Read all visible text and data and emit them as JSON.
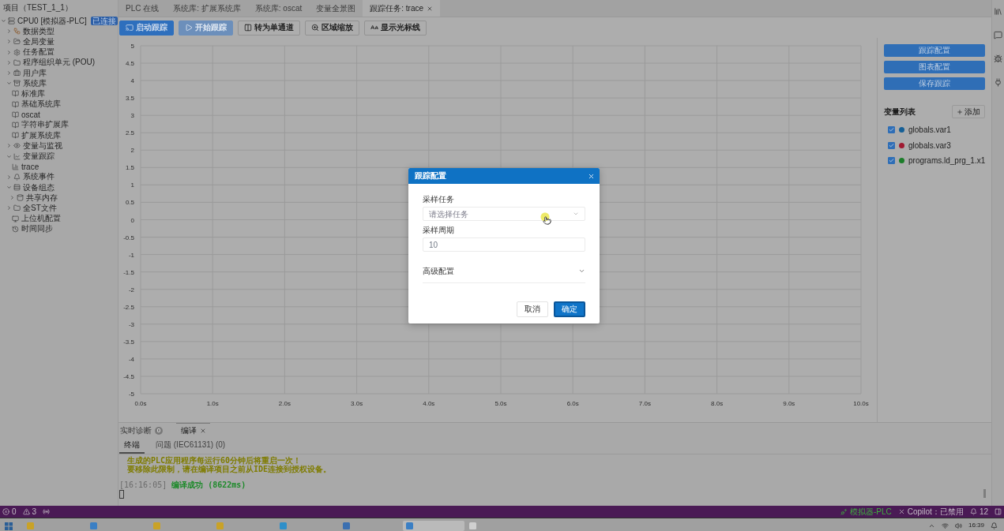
{
  "sidebar": {
    "title": "项目（TEST_1_1）",
    "tree": [
      {
        "label": "CPU0 [模拟器-PLC]",
        "badge": "已连接",
        "expanded": true,
        "children": [
          {
            "label": "数据类型",
            "expanded": false
          },
          {
            "label": "全局变量",
            "expanded": false
          },
          {
            "label": "任务配置",
            "expanded": false
          },
          {
            "label": "程序组织单元 (POU)",
            "expanded": false
          },
          {
            "label": "用户库",
            "expanded": false
          },
          {
            "label": "系统库",
            "expanded": true,
            "children": [
              {
                "label": "标准库"
              },
              {
                "label": "基础系统库"
              },
              {
                "label": "oscat"
              },
              {
                "label": "字符串扩展库"
              },
              {
                "label": "扩展系统库"
              }
            ]
          },
          {
            "label": "变量与监视",
            "expanded": false
          },
          {
            "label": "变量跟踪",
            "expanded": true,
            "children": [
              {
                "label": "trace"
              }
            ]
          },
          {
            "label": "系统事件",
            "expanded": false
          },
          {
            "label": "设备组态",
            "expanded": true,
            "children": [
              {
                "label": "共享内存",
                "expanded": false
              }
            ]
          },
          {
            "label": "全ST文件",
            "expanded": false
          },
          {
            "label": "上位机配置"
          },
          {
            "label": "时间同步"
          }
        ]
      }
    ]
  },
  "tabs": [
    {
      "label": "PLC 在线",
      "selected": false
    },
    {
      "label": "系统库: 扩展系统库",
      "selected": false
    },
    {
      "label": "系统库: oscat",
      "selected": false
    },
    {
      "label": "变量全景图",
      "selected": false
    },
    {
      "label": "跟踪任务: trace",
      "selected": true
    }
  ],
  "toolbar": [
    {
      "label": "启动跟踪",
      "kind": "primary",
      "disabled": false
    },
    {
      "label": "开始跟踪",
      "kind": "primary",
      "disabled": true
    },
    {
      "label": "转为单通道",
      "kind": "default",
      "disabled": false
    },
    {
      "label": "区域缩放",
      "kind": "default",
      "disabled": false
    },
    {
      "label": "显示光标线",
      "kind": "default",
      "disabled": false
    }
  ],
  "chart": {
    "chart_data": {
      "type": "line",
      "grid": true,
      "xlim": [
        0,
        10
      ],
      "ylim": [
        -5,
        5
      ],
      "xticks": [
        {
          "value": 0,
          "label": "0.0s"
        },
        {
          "value": 1,
          "label": "1.0s"
        },
        {
          "value": 2,
          "label": "2.0s"
        },
        {
          "value": 3,
          "label": "3.0s"
        },
        {
          "value": 4,
          "label": "4.0s"
        },
        {
          "value": 5,
          "label": "5.0s"
        },
        {
          "value": 6,
          "label": "6.0s"
        },
        {
          "value": 7,
          "label": "7.0s"
        },
        {
          "value": 8,
          "label": "8.0s"
        },
        {
          "value": 9,
          "label": "9.0s"
        },
        {
          "value": 10,
          "label": "10.0s"
        }
      ],
      "yticks": [
        5,
        4.5,
        4,
        3.5,
        3,
        2.5,
        2,
        1.5,
        1,
        0.5,
        0,
        -0.5,
        -1,
        -1.5,
        -2,
        -2.5,
        -3,
        -3.5,
        -4,
        -4.5,
        -5
      ]
    }
  },
  "trace_panel": {
    "buttons": [
      "跟踪配置",
      "图表配置",
      "保存跟踪"
    ],
    "variables_title": "变量列表",
    "add_button": "添加",
    "variables": [
      {
        "name": "globals.var1",
        "checked": true,
        "color": "#155f96"
      },
      {
        "name": "globals.var3",
        "checked": true,
        "color": "#a01a32"
      },
      {
        "name": "programs.ld_prg_1.x1",
        "checked": true,
        "color": "#1c7d2a"
      }
    ]
  },
  "bottom_panel": {
    "tabs": [
      {
        "label": "实时诊断",
        "badge": "0",
        "selected": false
      },
      {
        "label": "编译",
        "selected": true
      }
    ],
    "subtabs": [
      {
        "label": "终端",
        "selected": true
      },
      {
        "label": "问题 (IEC61131) (0)",
        "selected": false
      }
    ],
    "terminal": {
      "notices": [
        "生成的PLC应用程序每运行60分钟后将重启一次！",
        "要移除此限制，请在编译项目之前从IDE连接到授权设备。"
      ],
      "log": {
        "time": "[16:16:05]",
        "message": "编译成功",
        "duration": "(8622ms)"
      }
    }
  },
  "status_bar": {
    "errors": "0",
    "warnings": "3",
    "connection": "模拟器-PLC",
    "copilot": "Copilot：已禁用",
    "notifications": "12"
  },
  "taskbar": {
    "apps": [
      {
        "selected": false
      },
      {
        "selected": false
      },
      {
        "selected": false
      },
      {
        "selected": false
      },
      {
        "selected": false
      },
      {
        "selected": false
      },
      {
        "selected": true
      },
      {
        "selected": false
      }
    ],
    "clock": "16:39"
  },
  "dialog": {
    "title": "跟踪配置",
    "fields": [
      {
        "label": "采样任务",
        "kind": "select",
        "placeholder": "请选择任务"
      },
      {
        "label": "采样周期",
        "kind": "input",
        "value": "10"
      }
    ],
    "advanced": {
      "label": "高级配置",
      "expanded": false
    },
    "buttons": [
      {
        "label": "取消",
        "kind": "default"
      },
      {
        "label": "确定",
        "kind": "primary"
      }
    ]
  }
}
